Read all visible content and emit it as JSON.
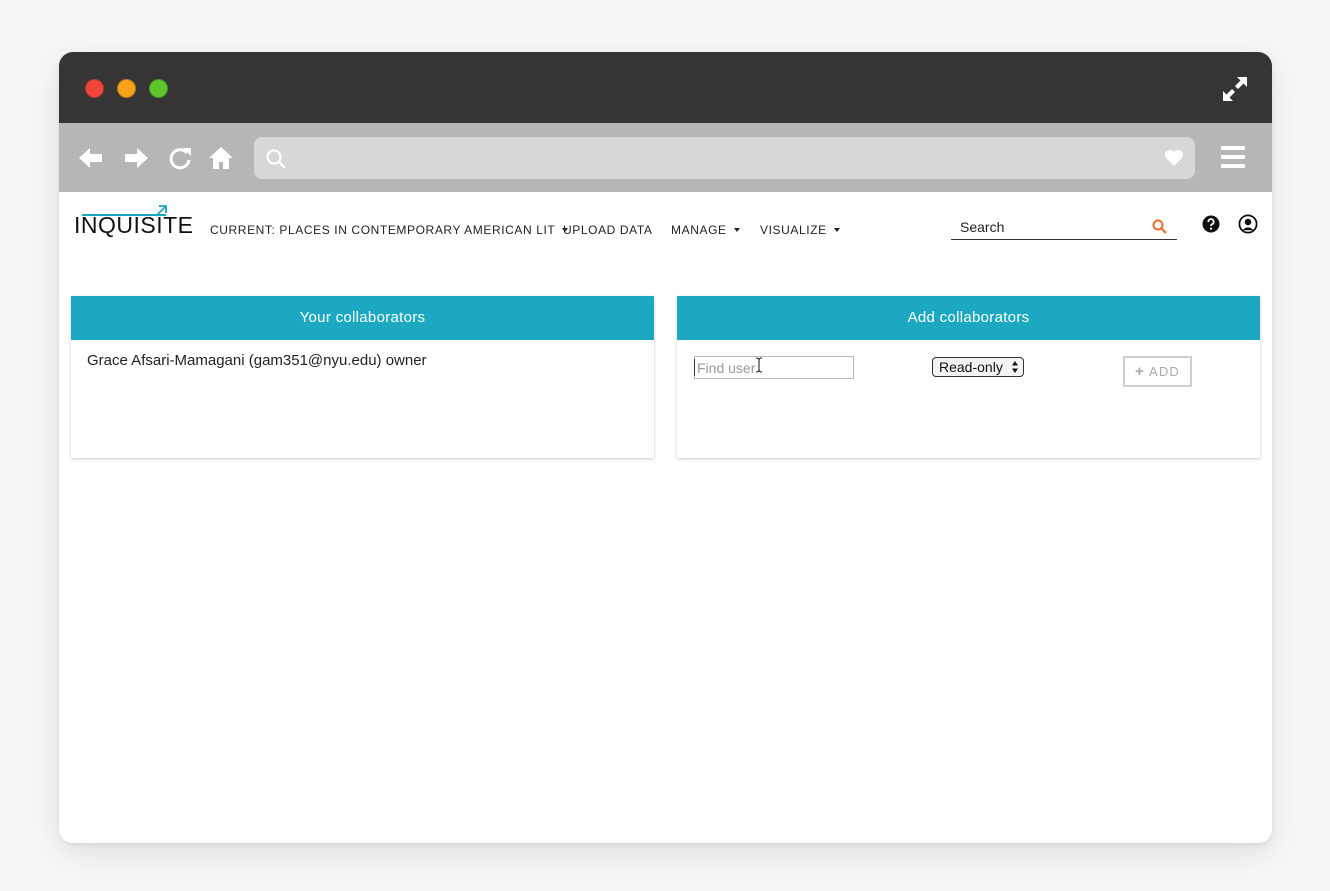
{
  "browser": {
    "url": ""
  },
  "app": {
    "logo_text": "INQUISITE",
    "menu": {
      "current": "CURRENT: PLACES IN CONTEMPORARY AMERICAN LIT",
      "upload": "UPLOAD DATA",
      "manage": "MANAGE",
      "visualize": "VISUALIZE"
    },
    "search": {
      "placeholder": "Search"
    },
    "accent_color": "#1ba8c0",
    "search_icon_color": "#e0742c"
  },
  "collaborators_panel": {
    "title": "Your collaborators",
    "items": [
      {
        "text": "Grace Afsari-Mamagani (gam351@nyu.edu) owner"
      }
    ]
  },
  "add_panel": {
    "title": "Add collaborators",
    "find_user_placeholder": "Find user",
    "find_user_value": "",
    "permission_selected": "Read-only",
    "add_label": "ADD"
  }
}
